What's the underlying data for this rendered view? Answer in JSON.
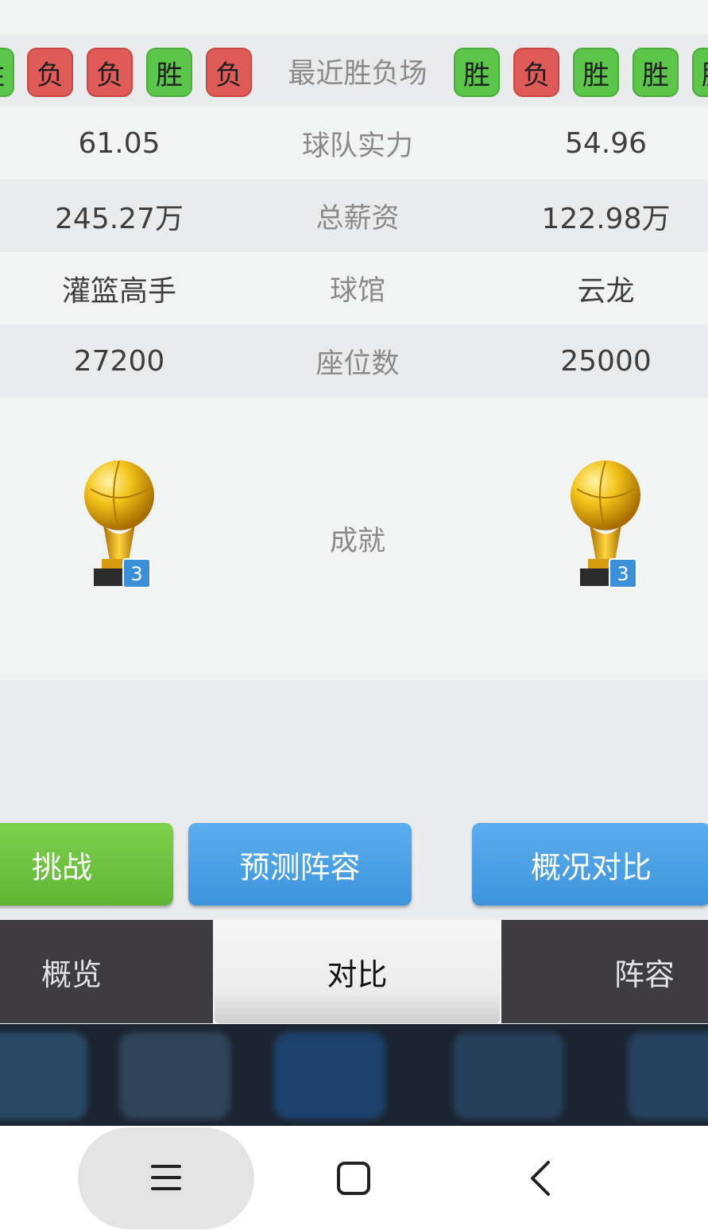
{
  "recent_games": {
    "label": "最近胜负场",
    "left": [
      "胜",
      "负",
      "负",
      "胜",
      "负"
    ],
    "right": [
      "胜",
      "负",
      "胜",
      "胜",
      "胜"
    ]
  },
  "stats": [
    {
      "label": "球队实力",
      "left": "61.05",
      "right": "54.96"
    },
    {
      "label": "总薪资",
      "left": "245.27万",
      "right": "122.98万"
    },
    {
      "label": "球馆",
      "left": "灌篮高手",
      "right": "云龙"
    },
    {
      "label": "座位数",
      "left": "27200",
      "right": "25000"
    }
  ],
  "achievements": {
    "label": "成就",
    "left_trophy_count": "3",
    "right_trophy_count": "3"
  },
  "actions": {
    "challenge": "挑战",
    "predict_lineup": "预测阵容",
    "overview_compare": "概况对比"
  },
  "tabs": {
    "overview": "概览",
    "compare": "对比",
    "lineup": "阵容"
  },
  "colors": {
    "win": "#5cc64a",
    "loss": "#de5b57",
    "accent_blue": "#4a9fe5",
    "accent_green": "#6cc23f"
  }
}
